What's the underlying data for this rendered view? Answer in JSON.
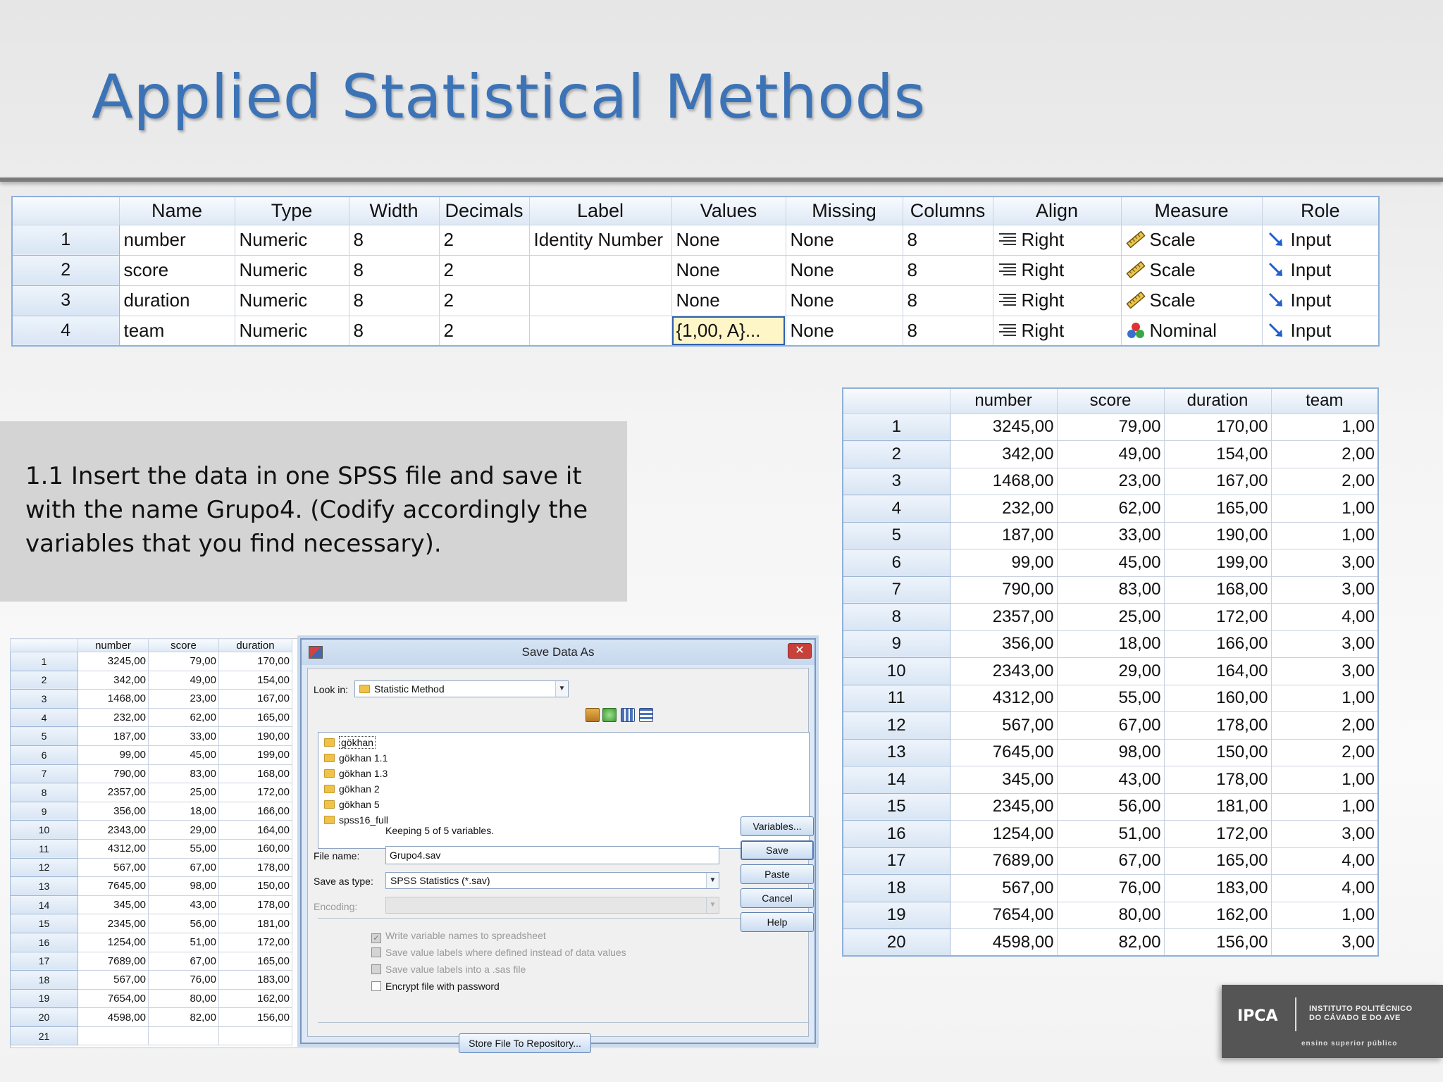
{
  "slide": {
    "title": "Applied Statistical Methods",
    "instruction": "1.1 Insert the data in one SPSS file and save it with the name Grupo4. (Codify accordingly the variables that you find necessary)."
  },
  "variable_view": {
    "headers": [
      "",
      "Name",
      "Type",
      "Width",
      "Decimals",
      "Label",
      "Values",
      "Missing",
      "Columns",
      "Align",
      "Measure",
      "Role"
    ],
    "rows": [
      {
        "num": "1",
        "name": "number",
        "type": "Numeric",
        "width": "8",
        "decimals": "2",
        "label": "Identity Number",
        "values": "None",
        "missing": "None",
        "columns": "8",
        "align": "Right",
        "measure": "Scale",
        "role": "Input"
      },
      {
        "num": "2",
        "name": "score",
        "type": "Numeric",
        "width": "8",
        "decimals": "2",
        "label": "",
        "values": "None",
        "missing": "None",
        "columns": "8",
        "align": "Right",
        "measure": "Scale",
        "role": "Input"
      },
      {
        "num": "3",
        "name": "duration",
        "type": "Numeric",
        "width": "8",
        "decimals": "2",
        "label": "",
        "values": "None",
        "missing": "None",
        "columns": "8",
        "align": "Right",
        "measure": "Scale",
        "role": "Input"
      },
      {
        "num": "4",
        "name": "team",
        "type": "Numeric",
        "width": "8",
        "decimals": "2",
        "label": "",
        "values": "{1,00, A}...",
        "missing": "None",
        "columns": "8",
        "align": "Right",
        "measure": "Nominal",
        "role": "Input"
      }
    ],
    "icons": {
      "align": "align-right-icon",
      "scale": "ruler-icon",
      "nominal": "nominal-icon",
      "role": "input-arrow-icon"
    }
  },
  "data_view_right": {
    "headers": [
      "",
      "number",
      "score",
      "duration",
      "team"
    ],
    "rows": [
      [
        "1",
        "3245,00",
        "79,00",
        "170,00",
        "1,00"
      ],
      [
        "2",
        "342,00",
        "49,00",
        "154,00",
        "2,00"
      ],
      [
        "3",
        "1468,00",
        "23,00",
        "167,00",
        "2,00"
      ],
      [
        "4",
        "232,00",
        "62,00",
        "165,00",
        "1,00"
      ],
      [
        "5",
        "187,00",
        "33,00",
        "190,00",
        "1,00"
      ],
      [
        "6",
        "99,00",
        "45,00",
        "199,00",
        "3,00"
      ],
      [
        "7",
        "790,00",
        "83,00",
        "168,00",
        "3,00"
      ],
      [
        "8",
        "2357,00",
        "25,00",
        "172,00",
        "4,00"
      ],
      [
        "9",
        "356,00",
        "18,00",
        "166,00",
        "3,00"
      ],
      [
        "10",
        "2343,00",
        "29,00",
        "164,00",
        "3,00"
      ],
      [
        "11",
        "4312,00",
        "55,00",
        "160,00",
        "1,00"
      ],
      [
        "12",
        "567,00",
        "67,00",
        "178,00",
        "2,00"
      ],
      [
        "13",
        "7645,00",
        "98,00",
        "150,00",
        "2,00"
      ],
      [
        "14",
        "345,00",
        "43,00",
        "178,00",
        "1,00"
      ],
      [
        "15",
        "2345,00",
        "56,00",
        "181,00",
        "1,00"
      ],
      [
        "16",
        "1254,00",
        "51,00",
        "172,00",
        "3,00"
      ],
      [
        "17",
        "7689,00",
        "67,00",
        "165,00",
        "4,00"
      ],
      [
        "18",
        "567,00",
        "76,00",
        "183,00",
        "4,00"
      ],
      [
        "19",
        "7654,00",
        "80,00",
        "162,00",
        "1,00"
      ],
      [
        "20",
        "4598,00",
        "82,00",
        "156,00",
        "3,00"
      ]
    ]
  },
  "data_view_left": {
    "headers": [
      "",
      "number",
      "score",
      "duration"
    ],
    "rows": [
      [
        "1",
        "3245,00",
        "79,00",
        "170,00"
      ],
      [
        "2",
        "342,00",
        "49,00",
        "154,00"
      ],
      [
        "3",
        "1468,00",
        "23,00",
        "167,00"
      ],
      [
        "4",
        "232,00",
        "62,00",
        "165,00"
      ],
      [
        "5",
        "187,00",
        "33,00",
        "190,00"
      ],
      [
        "6",
        "99,00",
        "45,00",
        "199,00"
      ],
      [
        "7",
        "790,00",
        "83,00",
        "168,00"
      ],
      [
        "8",
        "2357,00",
        "25,00",
        "172,00"
      ],
      [
        "9",
        "356,00",
        "18,00",
        "166,00"
      ],
      [
        "10",
        "2343,00",
        "29,00",
        "164,00"
      ],
      [
        "11",
        "4312,00",
        "55,00",
        "160,00"
      ],
      [
        "12",
        "567,00",
        "67,00",
        "178,00"
      ],
      [
        "13",
        "7645,00",
        "98,00",
        "150,00"
      ],
      [
        "14",
        "345,00",
        "43,00",
        "178,00"
      ],
      [
        "15",
        "2345,00",
        "56,00",
        "181,00"
      ],
      [
        "16",
        "1254,00",
        "51,00",
        "172,00"
      ],
      [
        "17",
        "7689,00",
        "67,00",
        "165,00"
      ],
      [
        "18",
        "567,00",
        "76,00",
        "183,00"
      ],
      [
        "19",
        "7654,00",
        "80,00",
        "162,00"
      ],
      [
        "20",
        "4598,00",
        "82,00",
        "156,00"
      ],
      [
        "21",
        "",
        "",
        ""
      ]
    ]
  },
  "save_dialog": {
    "title": "Save Data As",
    "look_in_label": "Look in:",
    "look_in_value": "Statistic Method",
    "folders": [
      "gökhan",
      "gökhan 1.1",
      "gökhan 1.3",
      "gökhan 2",
      "gökhan 5",
      "spss16_full"
    ],
    "keeping_text": "Keeping 5 of 5 variables.",
    "file_name_label": "File name:",
    "file_name_value": "Grupo4.sav",
    "save_as_type_label": "Save as type:",
    "save_as_type_value": "SPSS Statistics (*.sav)",
    "encoding_label": "Encoding:",
    "checkboxes": [
      {
        "label": "Write variable names to spreadsheet",
        "checked": true,
        "enabled": false
      },
      {
        "label": "Save value labels where defined instead of data values",
        "checked": false,
        "enabled": false
      },
      {
        "label": "Save value labels into a .sas file",
        "checked": false,
        "enabled": false
      },
      {
        "label": "Encrypt file with password",
        "checked": false,
        "enabled": true
      }
    ],
    "buttons": {
      "variables": "Variables...",
      "save": "Save",
      "paste": "Paste",
      "cancel": "Cancel",
      "help": "Help"
    },
    "store_button": "Store File To Repository..."
  },
  "logo": {
    "abbr": "IPCA",
    "name_line1": "INSTITUTO POLITÉCNICO",
    "name_line2": "DO CÁVADO E DO AVE",
    "tagline": "ensino superior público"
  }
}
